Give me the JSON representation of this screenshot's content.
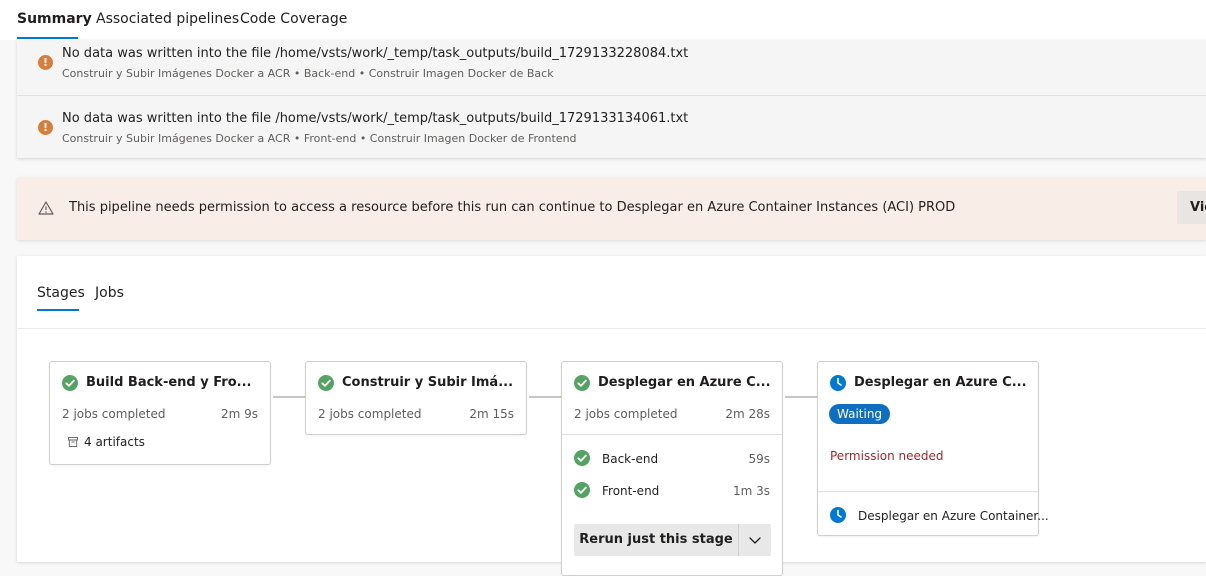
{
  "tabs": [
    {
      "label": "Summary",
      "active": true
    },
    {
      "label": "Associated pipelines",
      "active": false
    },
    {
      "label": "Code Coverage",
      "active": false
    }
  ],
  "issues": [
    {
      "icon": "error-icon",
      "title": "No data was written into the file /home/vsts/work/_temp/task_outputs/build_1729133228084.txt",
      "subtitle": "Construir y Subir Imágenes Docker a ACR • Back-end • Construir Imagen Docker de Back"
    },
    {
      "icon": "error-icon",
      "title": "No data was written into the file /home/vsts/work/_temp/task_outputs/build_1729133134061.txt",
      "subtitle": "Construir y Subir Imágenes Docker a ACR • Front-end • Construir Imagen Docker de Frontend"
    }
  ],
  "warning": {
    "icon": "warning-icon",
    "text": "This pipeline needs permission to access a resource before this run can continue to Desplegar en Azure Container Instances (ACI) PROD",
    "button": "Vie"
  },
  "stage_tabs": [
    {
      "label": "Stages",
      "active": true
    },
    {
      "label": "Jobs",
      "active": false
    }
  ],
  "colors": {
    "accent": "#0078d4",
    "success": "#55a362",
    "error": "#a4262c",
    "warning_bg": "#f9ede7"
  },
  "stages": [
    {
      "title": "Build Back-end y Fro...",
      "status": "success",
      "jobs": "2 jobs completed",
      "duration": "2m 9s",
      "artifacts": "4 artifacts"
    },
    {
      "title": "Construir y Subir Imá...",
      "status": "success",
      "jobs": "2 jobs completed",
      "duration": "2m 15s"
    },
    {
      "title": "Desplegar en Azure C...",
      "status": "success",
      "jobs": "2 jobs completed",
      "duration": "2m 28s",
      "job_list": [
        {
          "name": "Back-end",
          "duration": "59s"
        },
        {
          "name": "Front-end",
          "duration": "1m 3s"
        }
      ],
      "rerun_label": "Rerun just this stage"
    },
    {
      "title": "Desplegar en Azure C...",
      "status": "waiting",
      "badge": "Waiting",
      "message": "Permission needed",
      "job_list": [
        {
          "name": "Desplegar en Azure Container..."
        }
      ]
    }
  ]
}
